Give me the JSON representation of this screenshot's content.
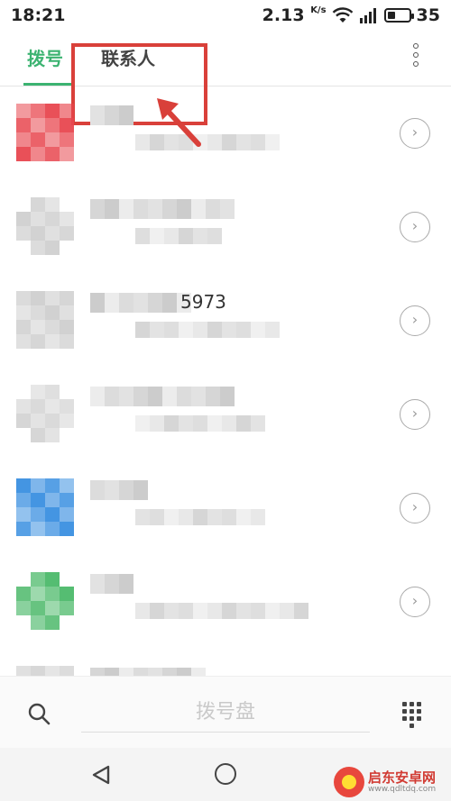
{
  "status_bar": {
    "time": "18:21",
    "speed": "2.13",
    "speed_unit": "K/s",
    "battery": "35",
    "battery_level": 0.35
  },
  "tabs": {
    "dial": "拨号",
    "contacts": "联系人"
  },
  "contacts": [
    {
      "partial_text": "",
      "avatar_color": "#e8474f"
    },
    {
      "partial_text": "",
      "avatar_color": "#d0d0d0"
    },
    {
      "partial_text": "5973",
      "avatar_color": "#cfcfcf"
    },
    {
      "partial_text": "",
      "avatar_color": "#d4d4d4"
    },
    {
      "partial_text": "",
      "avatar_color": "#3a8fe0"
    },
    {
      "partial_text": "",
      "avatar_color": "#4cb96a"
    },
    {
      "partial_text": "",
      "avatar_color": "#d0d0d0"
    }
  ],
  "detail_glyph": "›",
  "bottom_bar": {
    "dialpad_label": "拨号盘"
  },
  "watermark": {
    "brand": "启东安卓网",
    "url": "www.qdltdq.com"
  },
  "colors": {
    "accent": "#3cb371",
    "highlight": "#d9403a"
  },
  "icons": {
    "search": "search-icon",
    "more": "more-vertical-icon",
    "dialpad": "dialpad-icon",
    "back": "nav-back-icon",
    "home": "nav-home-icon",
    "detail": "chevron-right-circle-icon"
  }
}
